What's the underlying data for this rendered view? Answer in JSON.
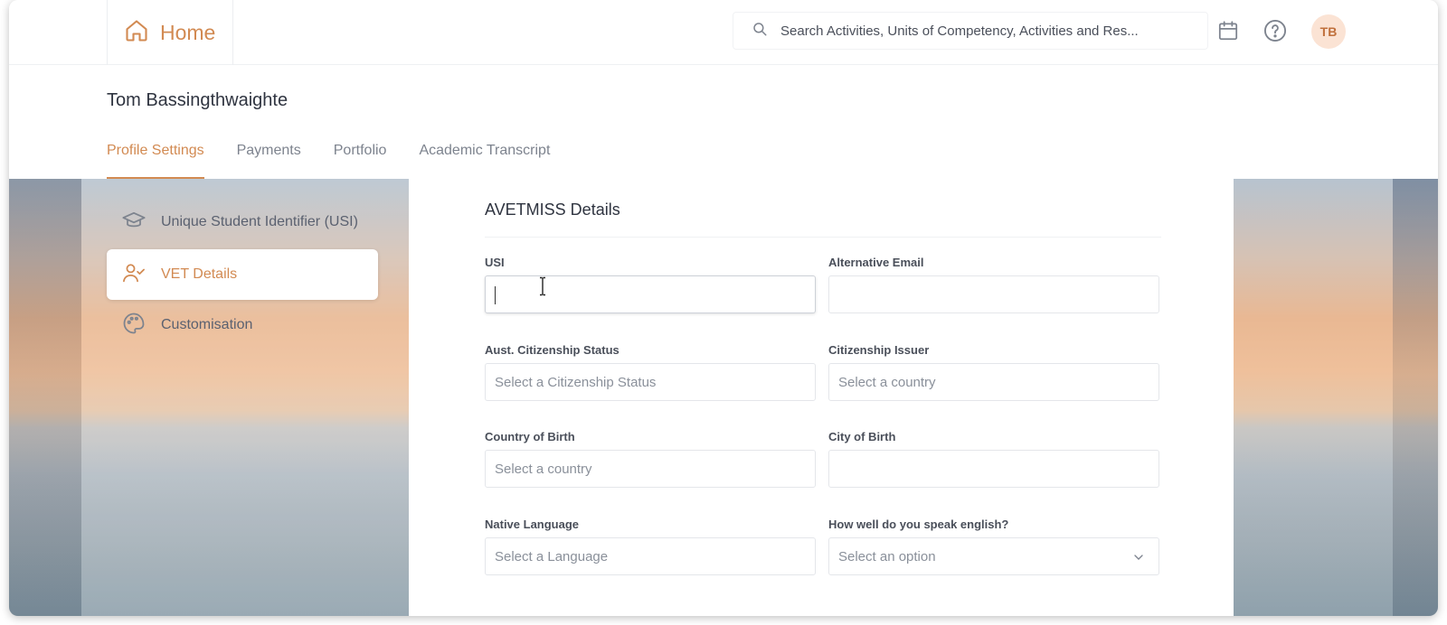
{
  "header": {
    "home_label": "Home",
    "search_placeholder": "Search Activities, Units of Competency, Activities and Res...",
    "avatar_initials": "TB",
    "icons": [
      "home-icon",
      "search-icon",
      "calendar-icon",
      "help-icon"
    ]
  },
  "profile": {
    "name": "Tom Bassingthwaighte"
  },
  "tabs": [
    {
      "label": "Profile Settings",
      "active": true
    },
    {
      "label": "Payments",
      "active": false
    },
    {
      "label": "Portfolio",
      "active": false
    },
    {
      "label": "Academic Transcript",
      "active": false
    }
  ],
  "sidenav": {
    "items": [
      {
        "label": "Unique Student Identifier (USI)",
        "icon": "graduation-cap-icon",
        "active": false
      },
      {
        "label": "VET Details",
        "icon": "user-check-icon",
        "active": true
      },
      {
        "label": "Customisation",
        "icon": "palette-icon",
        "active": false
      }
    ]
  },
  "form": {
    "title": "AVETMISS Details",
    "fields": [
      {
        "label": "USI",
        "value": "",
        "placeholder": ""
      },
      {
        "label": "Alternative Email",
        "value": "",
        "placeholder": ""
      },
      {
        "label": "Aust. Citizenship Status",
        "value": "",
        "placeholder": "Select a Citizenship Status"
      },
      {
        "label": "Citizenship Issuer",
        "value": "",
        "placeholder": "Select a country"
      },
      {
        "label": "Country of Birth",
        "value": "",
        "placeholder": "Select a country"
      },
      {
        "label": "City of Birth",
        "value": "",
        "placeholder": ""
      },
      {
        "label": "Native Language",
        "value": "",
        "placeholder": "Select a Language"
      },
      {
        "label": "How well do you speak english?",
        "value": "",
        "placeholder": "Select an option"
      }
    ]
  },
  "colors": {
    "accent": "#d28a52",
    "avatar_bg": "#fbe3d4",
    "text_dark": "#2f3440",
    "text_muted": "#7d838e"
  }
}
